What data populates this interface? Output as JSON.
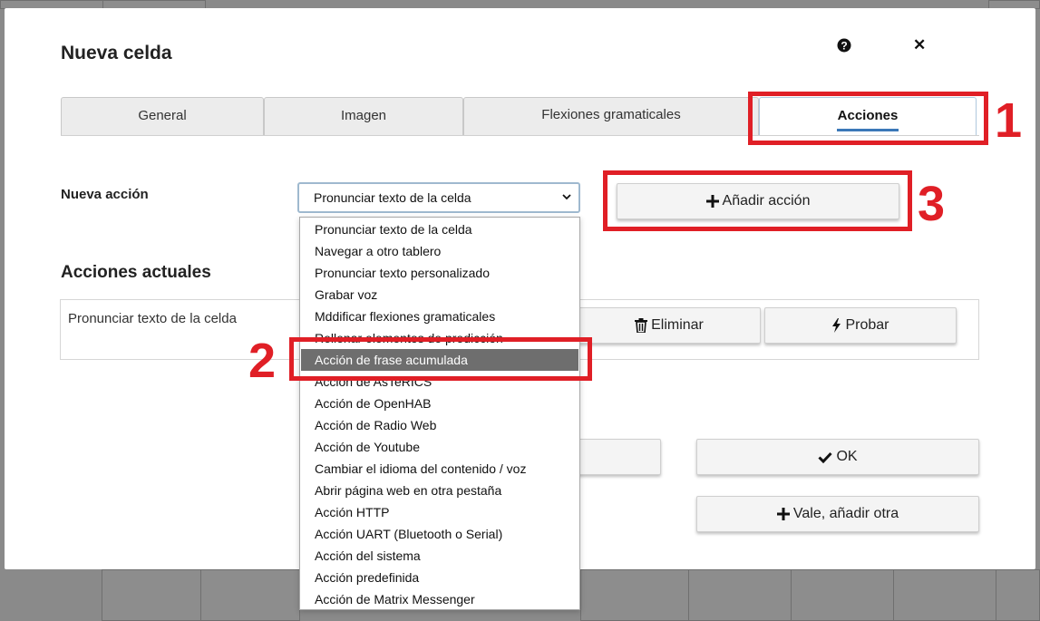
{
  "dialog": {
    "title": "Nueva celda"
  },
  "tabs": [
    {
      "label": "General",
      "active": false
    },
    {
      "label": "Imagen",
      "active": false
    },
    {
      "label": "Flexiones gramaticales",
      "active": false
    },
    {
      "label": "Acciones",
      "active": true
    }
  ],
  "new_action": {
    "label": "Nueva acción",
    "selected_value": "Pronunciar texto de la celda",
    "add_button_label": "Añadir acción"
  },
  "dropdown_options": [
    "Pronunciar texto de la celda",
    "Navegar a otro tablero",
    "Pronunciar texto personalizado",
    "Grabar voz",
    "Mddificar flexiones gramaticales",
    "Rellenar elementos de predicción",
    "Acción de frase acumulada",
    "Acción de AsTeRICS",
    "Acción de OpenHAB",
    "Acción de Radio Web",
    "Acción de Youtube",
    "Cambiar el idioma del contenido / voz",
    "Abrir página web en otra pestaña",
    "Acción HTTP",
    "Acción UART (Bluetooth o Serial)",
    "Acción del sistema",
    "Acción predefinida",
    "Acción de Matrix Messenger"
  ],
  "highlighted_option": "Acción de frase acumulada",
  "current_actions": {
    "title": "Acciones actuales",
    "items": [
      {
        "name": "Pronunciar texto de la celda",
        "delete_label": "Eliminar",
        "test_label": "Probar"
      }
    ]
  },
  "footer": {
    "ok_label": "OK",
    "ok_add_label": "Vale, añadir otra"
  },
  "annotations": {
    "tab_marker": "1",
    "option_marker": "2",
    "add_marker": "3"
  },
  "colors": {
    "annotation_red": "#e01f26",
    "tab_accent": "#3b78b8",
    "selected_option_bg": "#6e6e6e"
  }
}
